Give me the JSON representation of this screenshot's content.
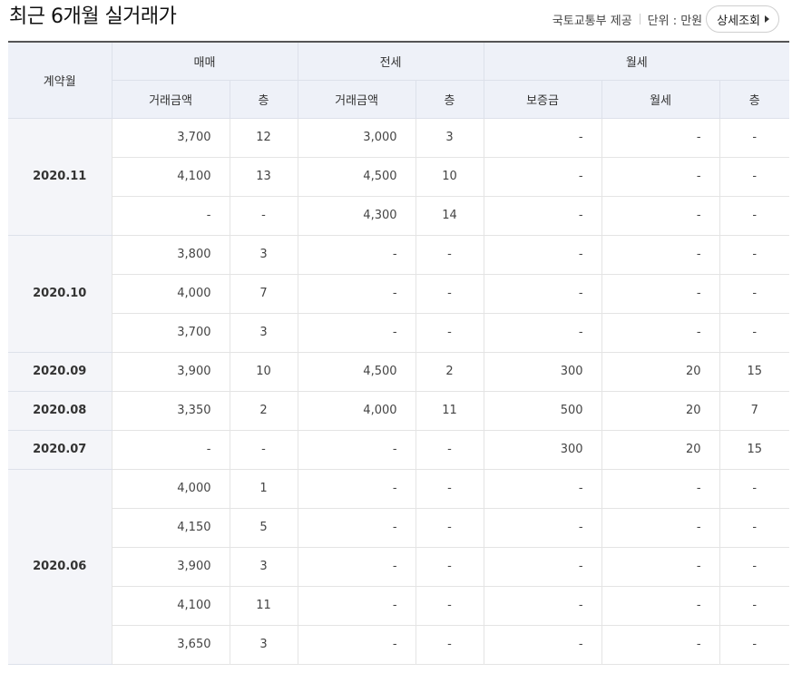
{
  "header": {
    "title": "최근 6개월 실거래가",
    "source": "국토교통부 제공",
    "unit": "단위 : 만원",
    "detail_button": "상세조회"
  },
  "table": {
    "month_header": "계약월",
    "groups": [
      "매매",
      "전세",
      "월세"
    ],
    "subheaders": [
      "거래금액",
      "층",
      "거래금액",
      "층",
      "보증금",
      "월세",
      "층"
    ],
    "months": [
      {
        "month": "2020.11",
        "rows": [
          [
            "3,700",
            "12",
            "3,000",
            "3",
            "-",
            "-",
            "-"
          ],
          [
            "4,100",
            "13",
            "4,500",
            "10",
            "-",
            "-",
            "-"
          ],
          [
            "-",
            "-",
            "4,300",
            "14",
            "-",
            "-",
            "-"
          ]
        ]
      },
      {
        "month": "2020.10",
        "rows": [
          [
            "3,800",
            "3",
            "-",
            "-",
            "-",
            "-",
            "-"
          ],
          [
            "4,000",
            "7",
            "-",
            "-",
            "-",
            "-",
            "-"
          ],
          [
            "3,700",
            "3",
            "-",
            "-",
            "-",
            "-",
            "-"
          ]
        ]
      },
      {
        "month": "2020.09",
        "rows": [
          [
            "3,900",
            "10",
            "4,500",
            "2",
            "300",
            "20",
            "15"
          ]
        ]
      },
      {
        "month": "2020.08",
        "rows": [
          [
            "3,350",
            "2",
            "4,000",
            "11",
            "500",
            "20",
            "7"
          ]
        ]
      },
      {
        "month": "2020.07",
        "rows": [
          [
            "-",
            "-",
            "-",
            "-",
            "300",
            "20",
            "15"
          ]
        ]
      },
      {
        "month": "2020.06",
        "rows": [
          [
            "4,000",
            "1",
            "-",
            "-",
            "-",
            "-",
            "-"
          ],
          [
            "4,150",
            "5",
            "-",
            "-",
            "-",
            "-",
            "-"
          ],
          [
            "3,900",
            "3",
            "-",
            "-",
            "-",
            "-",
            "-"
          ],
          [
            "4,100",
            "11",
            "-",
            "-",
            "-",
            "-",
            "-"
          ],
          [
            "3,650",
            "3",
            "-",
            "-",
            "-",
            "-",
            "-"
          ]
        ]
      }
    ]
  }
}
